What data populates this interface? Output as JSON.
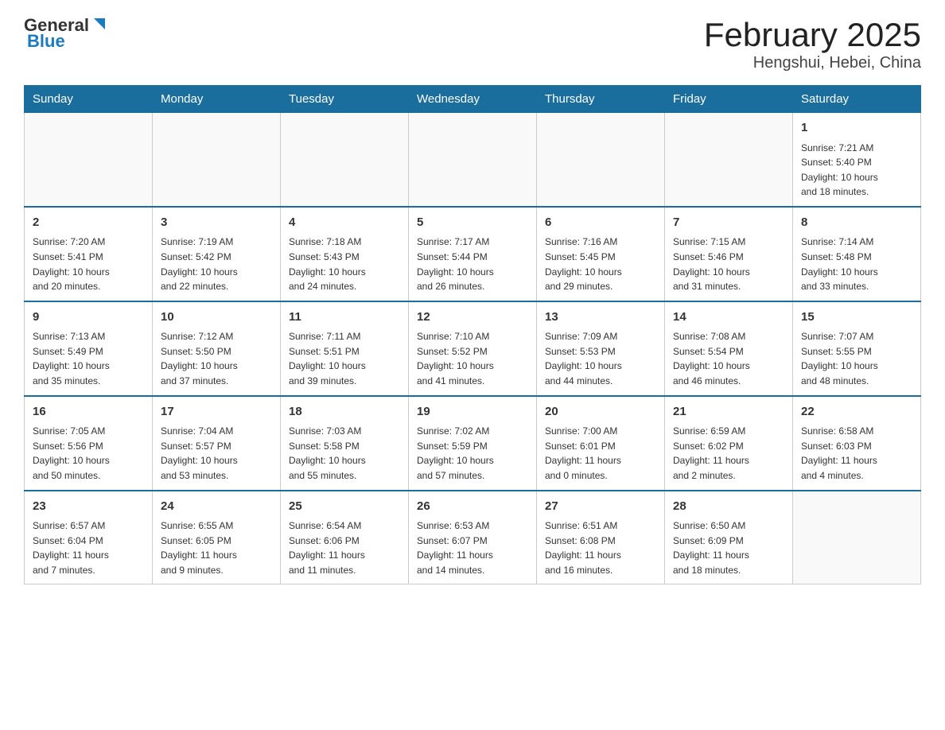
{
  "header": {
    "logo_line1": "General",
    "logo_line2": "Blue",
    "month_title": "February 2025",
    "location": "Hengshui, Hebei, China"
  },
  "weekdays": [
    "Sunday",
    "Monday",
    "Tuesday",
    "Wednesday",
    "Thursday",
    "Friday",
    "Saturday"
  ],
  "weeks": [
    [
      {
        "day": "",
        "info": ""
      },
      {
        "day": "",
        "info": ""
      },
      {
        "day": "",
        "info": ""
      },
      {
        "day": "",
        "info": ""
      },
      {
        "day": "",
        "info": ""
      },
      {
        "day": "",
        "info": ""
      },
      {
        "day": "1",
        "info": "Sunrise: 7:21 AM\nSunset: 5:40 PM\nDaylight: 10 hours\nand 18 minutes."
      }
    ],
    [
      {
        "day": "2",
        "info": "Sunrise: 7:20 AM\nSunset: 5:41 PM\nDaylight: 10 hours\nand 20 minutes."
      },
      {
        "day": "3",
        "info": "Sunrise: 7:19 AM\nSunset: 5:42 PM\nDaylight: 10 hours\nand 22 minutes."
      },
      {
        "day": "4",
        "info": "Sunrise: 7:18 AM\nSunset: 5:43 PM\nDaylight: 10 hours\nand 24 minutes."
      },
      {
        "day": "5",
        "info": "Sunrise: 7:17 AM\nSunset: 5:44 PM\nDaylight: 10 hours\nand 26 minutes."
      },
      {
        "day": "6",
        "info": "Sunrise: 7:16 AM\nSunset: 5:45 PM\nDaylight: 10 hours\nand 29 minutes."
      },
      {
        "day": "7",
        "info": "Sunrise: 7:15 AM\nSunset: 5:46 PM\nDaylight: 10 hours\nand 31 minutes."
      },
      {
        "day": "8",
        "info": "Sunrise: 7:14 AM\nSunset: 5:48 PM\nDaylight: 10 hours\nand 33 minutes."
      }
    ],
    [
      {
        "day": "9",
        "info": "Sunrise: 7:13 AM\nSunset: 5:49 PM\nDaylight: 10 hours\nand 35 minutes."
      },
      {
        "day": "10",
        "info": "Sunrise: 7:12 AM\nSunset: 5:50 PM\nDaylight: 10 hours\nand 37 minutes."
      },
      {
        "day": "11",
        "info": "Sunrise: 7:11 AM\nSunset: 5:51 PM\nDaylight: 10 hours\nand 39 minutes."
      },
      {
        "day": "12",
        "info": "Sunrise: 7:10 AM\nSunset: 5:52 PM\nDaylight: 10 hours\nand 41 minutes."
      },
      {
        "day": "13",
        "info": "Sunrise: 7:09 AM\nSunset: 5:53 PM\nDaylight: 10 hours\nand 44 minutes."
      },
      {
        "day": "14",
        "info": "Sunrise: 7:08 AM\nSunset: 5:54 PM\nDaylight: 10 hours\nand 46 minutes."
      },
      {
        "day": "15",
        "info": "Sunrise: 7:07 AM\nSunset: 5:55 PM\nDaylight: 10 hours\nand 48 minutes."
      }
    ],
    [
      {
        "day": "16",
        "info": "Sunrise: 7:05 AM\nSunset: 5:56 PM\nDaylight: 10 hours\nand 50 minutes."
      },
      {
        "day": "17",
        "info": "Sunrise: 7:04 AM\nSunset: 5:57 PM\nDaylight: 10 hours\nand 53 minutes."
      },
      {
        "day": "18",
        "info": "Sunrise: 7:03 AM\nSunset: 5:58 PM\nDaylight: 10 hours\nand 55 minutes."
      },
      {
        "day": "19",
        "info": "Sunrise: 7:02 AM\nSunset: 5:59 PM\nDaylight: 10 hours\nand 57 minutes."
      },
      {
        "day": "20",
        "info": "Sunrise: 7:00 AM\nSunset: 6:01 PM\nDaylight: 11 hours\nand 0 minutes."
      },
      {
        "day": "21",
        "info": "Sunrise: 6:59 AM\nSunset: 6:02 PM\nDaylight: 11 hours\nand 2 minutes."
      },
      {
        "day": "22",
        "info": "Sunrise: 6:58 AM\nSunset: 6:03 PM\nDaylight: 11 hours\nand 4 minutes."
      }
    ],
    [
      {
        "day": "23",
        "info": "Sunrise: 6:57 AM\nSunset: 6:04 PM\nDaylight: 11 hours\nand 7 minutes."
      },
      {
        "day": "24",
        "info": "Sunrise: 6:55 AM\nSunset: 6:05 PM\nDaylight: 11 hours\nand 9 minutes."
      },
      {
        "day": "25",
        "info": "Sunrise: 6:54 AM\nSunset: 6:06 PM\nDaylight: 11 hours\nand 11 minutes."
      },
      {
        "day": "26",
        "info": "Sunrise: 6:53 AM\nSunset: 6:07 PM\nDaylight: 11 hours\nand 14 minutes."
      },
      {
        "day": "27",
        "info": "Sunrise: 6:51 AM\nSunset: 6:08 PM\nDaylight: 11 hours\nand 16 minutes."
      },
      {
        "day": "28",
        "info": "Sunrise: 6:50 AM\nSunset: 6:09 PM\nDaylight: 11 hours\nand 18 minutes."
      },
      {
        "day": "",
        "info": ""
      }
    ]
  ]
}
